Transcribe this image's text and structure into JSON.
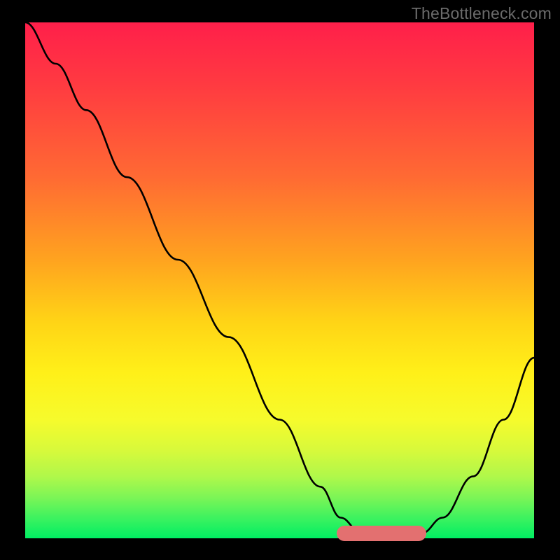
{
  "watermark": "TheBottleneck.com",
  "chart_data": {
    "type": "line",
    "title": "",
    "xlabel": "",
    "ylabel": "",
    "xlim": [
      0,
      100
    ],
    "ylim": [
      0,
      100
    ],
    "grid": false,
    "series": [
      {
        "name": "bottleneck-curve",
        "x": [
          0,
          6,
          12,
          20,
          30,
          40,
          50,
          58,
          62,
          66,
          70,
          74,
          78,
          82,
          88,
          94,
          100
        ],
        "values": [
          100,
          92,
          83,
          70,
          54,
          39,
          23,
          10,
          4,
          1,
          0,
          0,
          1,
          4,
          12,
          23,
          35
        ]
      }
    ],
    "flat_segment": {
      "x_start": 62,
      "x_end": 78,
      "y": 1
    },
    "background_gradient": {
      "top": "#ff1f4a",
      "middle": "#fff019",
      "bottom": "#00ef63"
    }
  },
  "colors": {
    "curve": "#000000",
    "flat_marker": "#e37070",
    "frame": "#000000",
    "watermark_text": "#6b6b6b"
  }
}
